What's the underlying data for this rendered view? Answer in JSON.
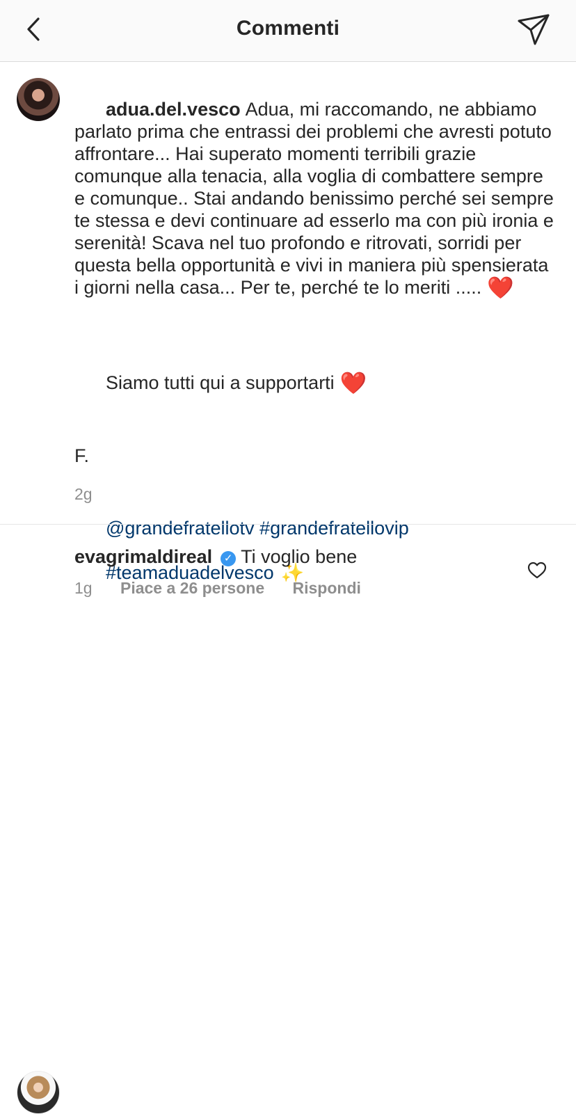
{
  "header": {
    "title": "Commenti",
    "back_icon": "chevron-left-icon",
    "share_icon": "paper-plane-icon"
  },
  "post": {
    "username": "adua.del.vesco",
    "paragraph_1": "Adua, mi raccomando, ne abbiamo parlato prima che entrassi dei problemi che avresti potuto affrontare... Hai superato momenti terribili grazie comunque alla tenacia, alla voglia di combattere sempre e comunque.. Stai andando benissimo perché sei sempre te stessa e devi continuare ad esserlo ma con più ironia e serenità! Scava nel tuo profondo e ritrovati, sorridi per questa bella opportunità e vivi in maniera più spensierata i giorni nella casa... Per te, perché te lo meriti .....",
    "paragraph_2": "Siamo tutti qui a supportarti",
    "paragraph_3": "F.",
    "tag_1": "@grandefratellotv",
    "tag_2": "#grandefratellovip",
    "tag_3": "#teamaduadelvesco",
    "emoji_heart": "❤️",
    "emoji_sparkles": "✨",
    "time": "2g"
  },
  "comment": {
    "username": "evagrimaldireal",
    "verified_icon": "verified-badge-icon",
    "text": "Ti voglio bene",
    "time": "1g",
    "likes": "Piace a 26 persone",
    "reply": "Rispondi",
    "like_icon": "heart-outline-icon"
  },
  "colors": {
    "text": "#262626",
    "secondary": "#8e8e8e",
    "link": "#00376b",
    "verified": "#3897f0",
    "heart": "#e3173d"
  }
}
